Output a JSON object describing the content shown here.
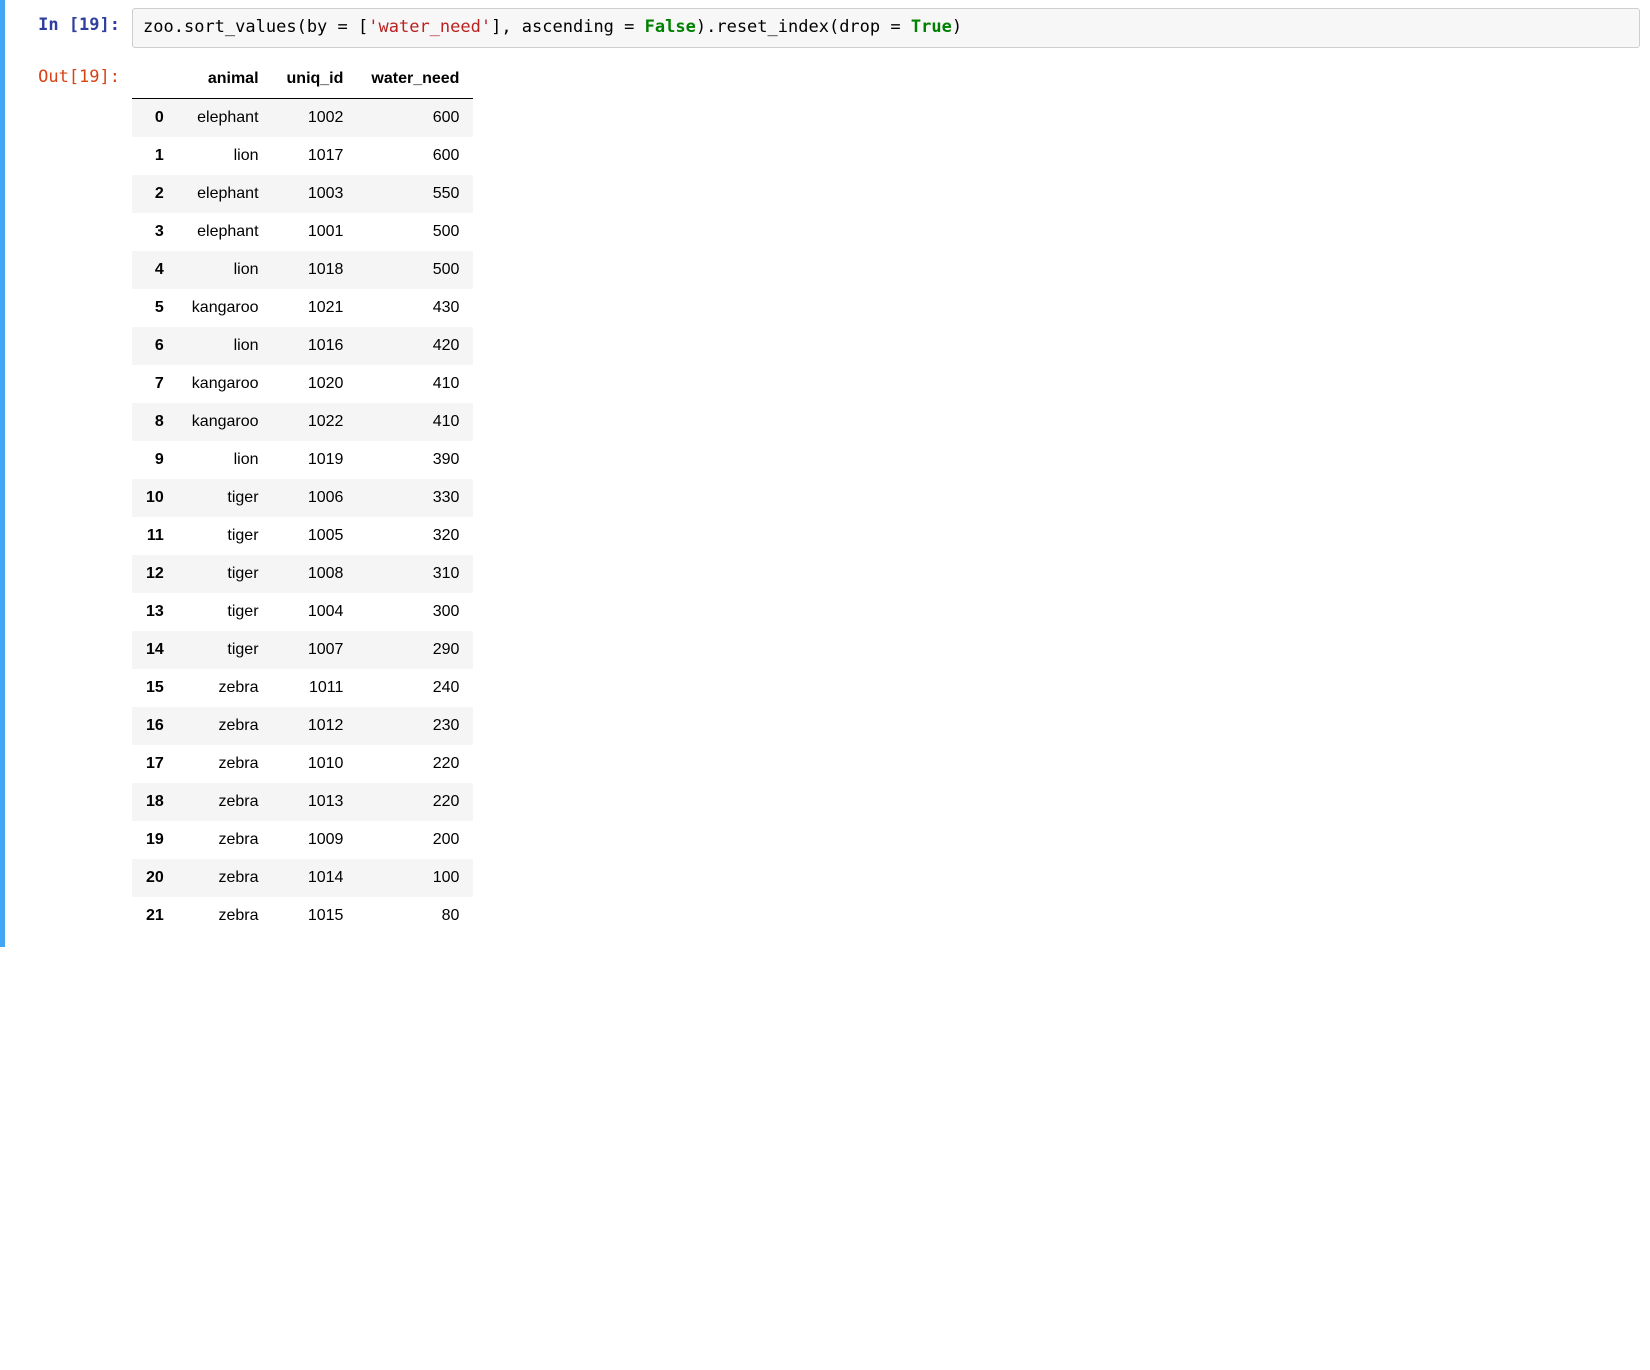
{
  "input_prompt": "In [19]:",
  "output_prompt": "Out[19]:",
  "code": {
    "t1": "zoo",
    "t2": ".",
    "t3": "sort_values",
    "t4": "(",
    "t5": "by ",
    "t6": "=",
    "t7": " [",
    "t8": "'water_need'",
    "t9": "], ascending ",
    "t10": "=",
    "t11": " ",
    "t12": "False",
    "t13": ")",
    "t14": ".",
    "t15": "reset_index",
    "t16": "(",
    "t17": "drop ",
    "t18": "=",
    "t19": " ",
    "t20": "True",
    "t21": ")"
  },
  "table": {
    "columns": [
      "animal",
      "uniq_id",
      "water_need"
    ],
    "rows": [
      {
        "idx": "0",
        "animal": "elephant",
        "uniq_id": "1002",
        "water_need": "600"
      },
      {
        "idx": "1",
        "animal": "lion",
        "uniq_id": "1017",
        "water_need": "600"
      },
      {
        "idx": "2",
        "animal": "elephant",
        "uniq_id": "1003",
        "water_need": "550"
      },
      {
        "idx": "3",
        "animal": "elephant",
        "uniq_id": "1001",
        "water_need": "500"
      },
      {
        "idx": "4",
        "animal": "lion",
        "uniq_id": "1018",
        "water_need": "500"
      },
      {
        "idx": "5",
        "animal": "kangaroo",
        "uniq_id": "1021",
        "water_need": "430"
      },
      {
        "idx": "6",
        "animal": "lion",
        "uniq_id": "1016",
        "water_need": "420"
      },
      {
        "idx": "7",
        "animal": "kangaroo",
        "uniq_id": "1020",
        "water_need": "410"
      },
      {
        "idx": "8",
        "animal": "kangaroo",
        "uniq_id": "1022",
        "water_need": "410"
      },
      {
        "idx": "9",
        "animal": "lion",
        "uniq_id": "1019",
        "water_need": "390"
      },
      {
        "idx": "10",
        "animal": "tiger",
        "uniq_id": "1006",
        "water_need": "330"
      },
      {
        "idx": "11",
        "animal": "tiger",
        "uniq_id": "1005",
        "water_need": "320"
      },
      {
        "idx": "12",
        "animal": "tiger",
        "uniq_id": "1008",
        "water_need": "310"
      },
      {
        "idx": "13",
        "animal": "tiger",
        "uniq_id": "1004",
        "water_need": "300"
      },
      {
        "idx": "14",
        "animal": "tiger",
        "uniq_id": "1007",
        "water_need": "290"
      },
      {
        "idx": "15",
        "animal": "zebra",
        "uniq_id": "1011",
        "water_need": "240"
      },
      {
        "idx": "16",
        "animal": "zebra",
        "uniq_id": "1012",
        "water_need": "230"
      },
      {
        "idx": "17",
        "animal": "zebra",
        "uniq_id": "1010",
        "water_need": "220"
      },
      {
        "idx": "18",
        "animal": "zebra",
        "uniq_id": "1013",
        "water_need": "220"
      },
      {
        "idx": "19",
        "animal": "zebra",
        "uniq_id": "1009",
        "water_need": "200"
      },
      {
        "idx": "20",
        "animal": "zebra",
        "uniq_id": "1014",
        "water_need": "100"
      },
      {
        "idx": "21",
        "animal": "zebra",
        "uniq_id": "1015",
        "water_need": "80"
      }
    ]
  }
}
